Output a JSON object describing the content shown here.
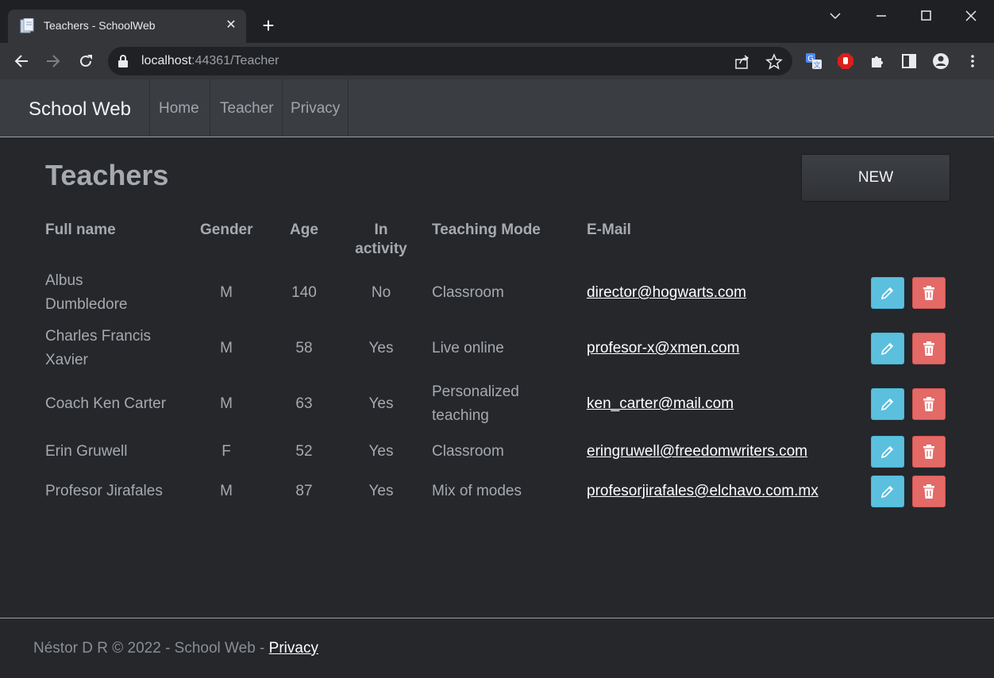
{
  "browser": {
    "tab_title": "Teachers - SchoolWeb",
    "url_host": "localhost",
    "url_rest": ":44361/Teacher"
  },
  "navbar": {
    "brand": "School Web",
    "links": [
      "Home",
      "Teacher",
      "Privacy"
    ]
  },
  "main": {
    "title": "Teachers",
    "new_button": "NEW",
    "columns": {
      "full_name": "Full name",
      "gender": "Gender",
      "age": "Age",
      "in_activity_1": "In",
      "in_activity_2": "activity",
      "teaching_mode": "Teaching Mode",
      "email": "E-Mail"
    },
    "rows": [
      {
        "name_1": "Albus",
        "name_2": "Dumbledore",
        "gender": "M",
        "age": "140",
        "active": "No",
        "mode_1": "Classroom",
        "mode_2": "",
        "email": "director@hogwarts.com"
      },
      {
        "name_1": "Charles Francis",
        "name_2": "Xavier",
        "gender": "M",
        "age": "58",
        "active": "Yes",
        "mode_1": "Live online",
        "mode_2": "",
        "email": "profesor-x@xmen.com"
      },
      {
        "name_1": "Coach Ken Carter",
        "name_2": "",
        "gender": "M",
        "age": "63",
        "active": "Yes",
        "mode_1": "Personalized",
        "mode_2": "teaching",
        "email": "ken_carter@mail.com"
      },
      {
        "name_1": "Erin Gruwell",
        "name_2": "",
        "gender": "F",
        "age": "52",
        "active": "Yes",
        "mode_1": "Classroom",
        "mode_2": "",
        "email": "eringruwell@freedomwriters.com"
      },
      {
        "name_1": "Profesor Jirafales",
        "name_2": "",
        "gender": "M",
        "age": "87",
        "active": "Yes",
        "mode_1": "Mix of modes",
        "mode_2": "",
        "email": "profesorjirafales@elchavo.com.mx"
      }
    ]
  },
  "footer": {
    "text": "Néstor D R © 2022 - School Web - ",
    "privacy_link": "Privacy"
  },
  "colors": {
    "page_bg": "#25272b",
    "navbar_bg": "#3a3d42",
    "edit_button": "#5bc0de",
    "delete_button": "#e36a67"
  },
  "icons": [
    "document-favicon",
    "close-icon",
    "plus-icon",
    "chevron-down-icon",
    "minimize-icon",
    "maximize-icon",
    "window-close-icon",
    "back-icon",
    "forward-icon",
    "reload-icon",
    "lock-icon",
    "share-icon",
    "star-icon",
    "translate-icon",
    "adblock-icon",
    "puzzle-icon",
    "side-panel-icon",
    "profile-icon",
    "menu-dots-icon",
    "pencil-icon",
    "trash-icon"
  ]
}
